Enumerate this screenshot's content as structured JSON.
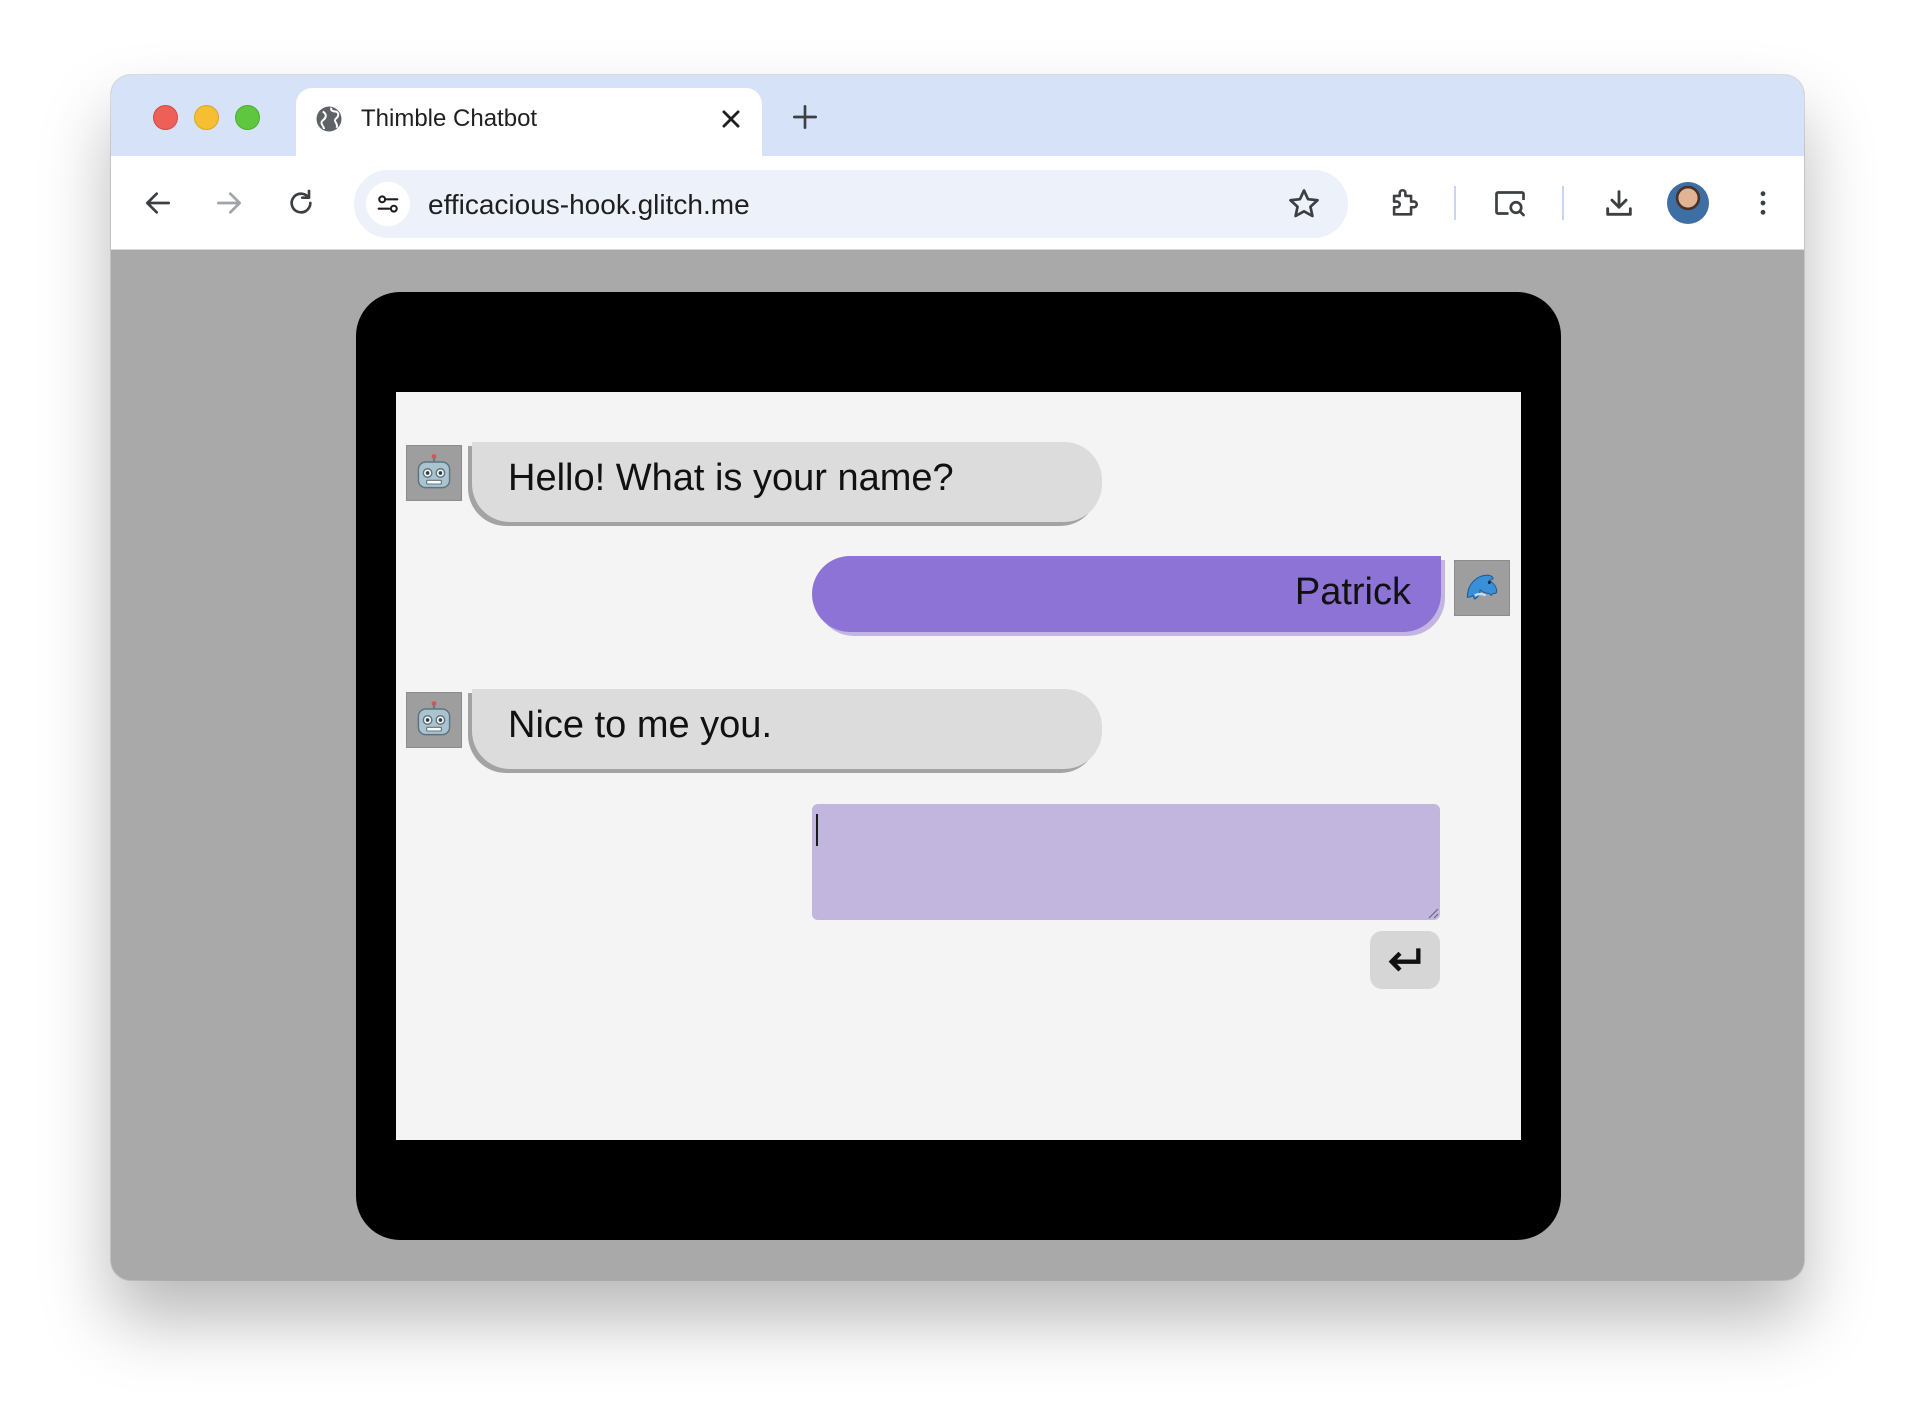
{
  "browser": {
    "tab": {
      "title": "Thimble Chatbot",
      "icon": "globe-icon"
    },
    "address_bar": {
      "url": "efficacious-hook.glitch.me"
    },
    "toolbar_icons": [
      "back-icon",
      "forward-icon",
      "reload-icon",
      "site-info-icon",
      "bookmark-star-icon",
      "extensions-icon",
      "screen-search-icon",
      "download-icon",
      "profile-avatar",
      "more-menu-icon"
    ]
  },
  "chat": {
    "messages": [
      {
        "sender": "bot",
        "avatar": "robot-icon",
        "text": "Hello! What is your name?"
      },
      {
        "sender": "user",
        "avatar": "dolphin-icon",
        "text": "Patrick"
      },
      {
        "sender": "bot",
        "avatar": "robot-icon",
        "text": "Nice to me you."
      }
    ],
    "reply_input": {
      "value": "",
      "placeholder": ""
    },
    "send_icon": "enter-return-icon"
  },
  "colors": {
    "page_background": "#a9a9a9",
    "device_frame": "#000000",
    "screen_background": "#f4f4f4",
    "bot_bubble": "#dcdcdc",
    "user_bubble": "#8d73d6",
    "reply_input": "#c2b6df",
    "tab_strip": "#d6e2f8"
  }
}
